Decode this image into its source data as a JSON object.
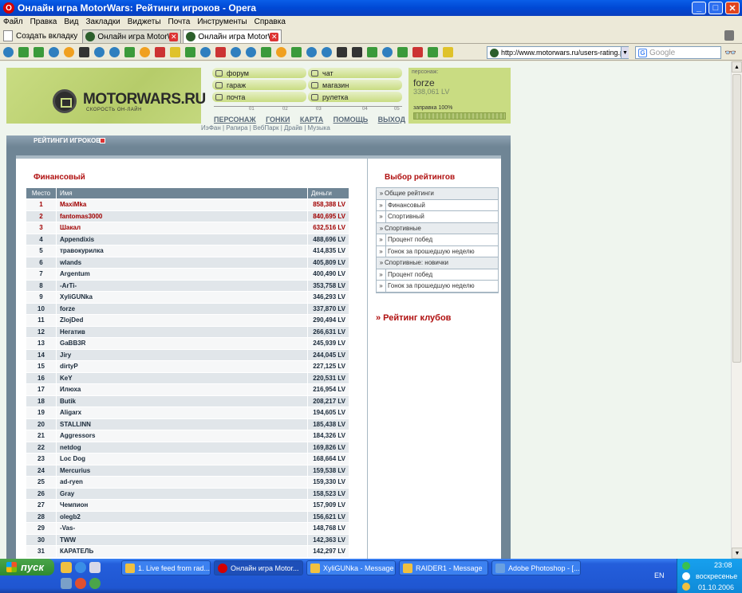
{
  "window": {
    "title": "Онлайн игра MotorWars: Рейтинги игроков - Opera",
    "buttons": [
      "_",
      "□",
      "✕"
    ]
  },
  "menu": [
    "Файл",
    "Правка",
    "Вид",
    "Закладки",
    "Виджеты",
    "Почта",
    "Инструменты",
    "Справка"
  ],
  "tabs": {
    "new_tab": "Создать вкладку",
    "items": [
      {
        "label": "Онлайн игра MotorWars..."
      },
      {
        "label": "Онлайн игра MotorWars..."
      }
    ]
  },
  "toolbar": {
    "url": "http://www.motorwars.ru/users-rating.php",
    "search_placeholder": "Google"
  },
  "site": {
    "logo": "MOTORWARS.RU",
    "logo_sub": "СКОРОСТЬ ОН-ЛАЙН",
    "nav_left": [
      "форум",
      "гараж",
      "почта"
    ],
    "nav_right": [
      "чат",
      "магазин",
      "рулетка"
    ],
    "progress_marks": [
      "01",
      "02",
      "03",
      "04",
      "05"
    ],
    "main_nav": [
      "ПЕРСОНАЖ",
      "ГОНКИ",
      "КАРТА",
      "ПОМОЩЬ",
      "ВЫХОД"
    ],
    "sub_nav": "ИэФан | Рапира | ВебПарк | Драйв | Музыка",
    "character": {
      "label": "персонаж:",
      "name": "forze",
      "lv": "338,061 LV",
      "fuel": "заправка 100%",
      "fuel_level": 1.0
    },
    "section_title": "РЕЙТИНГИ ИГРОКОВ",
    "ratings": {
      "title": "Финансовый",
      "columns": [
        "Место",
        "Имя",
        "Деньги"
      ],
      "rows": [
        {
          "place": "1",
          "name": "MaxiMka",
          "money": "858,388 LV"
        },
        {
          "place": "2",
          "name": "fantomas3000",
          "money": "840,695 LV"
        },
        {
          "place": "3",
          "name": "Шакал",
          "money": "632,516 LV"
        },
        {
          "place": "4",
          "name": "Appendixis",
          "money": "488,696 LV"
        },
        {
          "place": "5",
          "name": "травокурилка",
          "money": "414,835 LV"
        },
        {
          "place": "6",
          "name": "wlands",
          "money": "405,809 LV"
        },
        {
          "place": "7",
          "name": "Argentum",
          "money": "400,490 LV"
        },
        {
          "place": "8",
          "name": "-ArTi-",
          "money": "353,758 LV"
        },
        {
          "place": "9",
          "name": "XyliGUNka",
          "money": "346,293 LV"
        },
        {
          "place": "10",
          "name": "forze",
          "money": "337,870 LV"
        },
        {
          "place": "11",
          "name": "ZlojDed",
          "money": "290,494 LV"
        },
        {
          "place": "12",
          "name": "Негатив",
          "money": "266,631 LV"
        },
        {
          "place": "13",
          "name": "GaBB3R",
          "money": "245,939 LV"
        },
        {
          "place": "14",
          "name": "Jiry",
          "money": "244,045 LV"
        },
        {
          "place": "15",
          "name": "dirtyP",
          "money": "227,125 LV"
        },
        {
          "place": "16",
          "name": "KeY",
          "money": "220,531 LV"
        },
        {
          "place": "17",
          "name": "Илюха",
          "money": "216,954 LV"
        },
        {
          "place": "18",
          "name": "Butik",
          "money": "208,217 LV"
        },
        {
          "place": "19",
          "name": "Aligarx",
          "money": "194,605 LV"
        },
        {
          "place": "20",
          "name": "STALLINN",
          "money": "185,438 LV"
        },
        {
          "place": "21",
          "name": "Aggressors",
          "money": "184,326 LV"
        },
        {
          "place": "22",
          "name": "netdog",
          "money": "169,826 LV"
        },
        {
          "place": "23",
          "name": "Loc Dog",
          "money": "168,664 LV"
        },
        {
          "place": "24",
          "name": "Mercurius",
          "money": "159,538 LV"
        },
        {
          "place": "25",
          "name": "ad-ryen",
          "money": "159,330 LV"
        },
        {
          "place": "26",
          "name": "Gray",
          "money": "158,523 LV"
        },
        {
          "place": "27",
          "name": "Чемпион",
          "money": "157,909 LV"
        },
        {
          "place": "28",
          "name": "olegb2",
          "money": "156,621 LV"
        },
        {
          "place": "29",
          "name": "-Vas-",
          "money": "148,768 LV"
        },
        {
          "place": "30",
          "name": "TWW",
          "money": "142,363 LV"
        },
        {
          "place": "31",
          "name": "КАРАТЕЛЬ",
          "money": "142,297 LV"
        }
      ]
    },
    "choice": {
      "title": "Выбор рейтингов",
      "items": [
        {
          "label": "Общие рейтинги",
          "kind": "cat"
        },
        {
          "label": "Финансовый",
          "kind": "sub"
        },
        {
          "label": "Спортивный",
          "kind": "sub"
        },
        {
          "label": "Спортивные",
          "kind": "cat"
        },
        {
          "label": "Процент побед",
          "kind": "sub"
        },
        {
          "label": "Гонок за прошедшую неделю",
          "kind": "sub"
        },
        {
          "label": "Спортивные: новички",
          "kind": "cat"
        },
        {
          "label": "Процент побед",
          "kind": "sub"
        },
        {
          "label": "Гонок за прошедшую неделю",
          "kind": "sub"
        }
      ],
      "clubs_link": "» Рейтинг клубов"
    }
  },
  "taskbar": {
    "start": "пуск",
    "tasks": [
      {
        "label": "1. Live feed from rad..."
      },
      {
        "label": "Онлайн игра Motor..."
      },
      {
        "label": "XyliGUNka - Message"
      },
      {
        "label": "RAIDER1 - Message"
      },
      {
        "label": "Adobe Photoshop - [..."
      }
    ],
    "lang": "EN",
    "time": "23:08",
    "day": "воскресенье",
    "date": "01.10.2006"
  }
}
